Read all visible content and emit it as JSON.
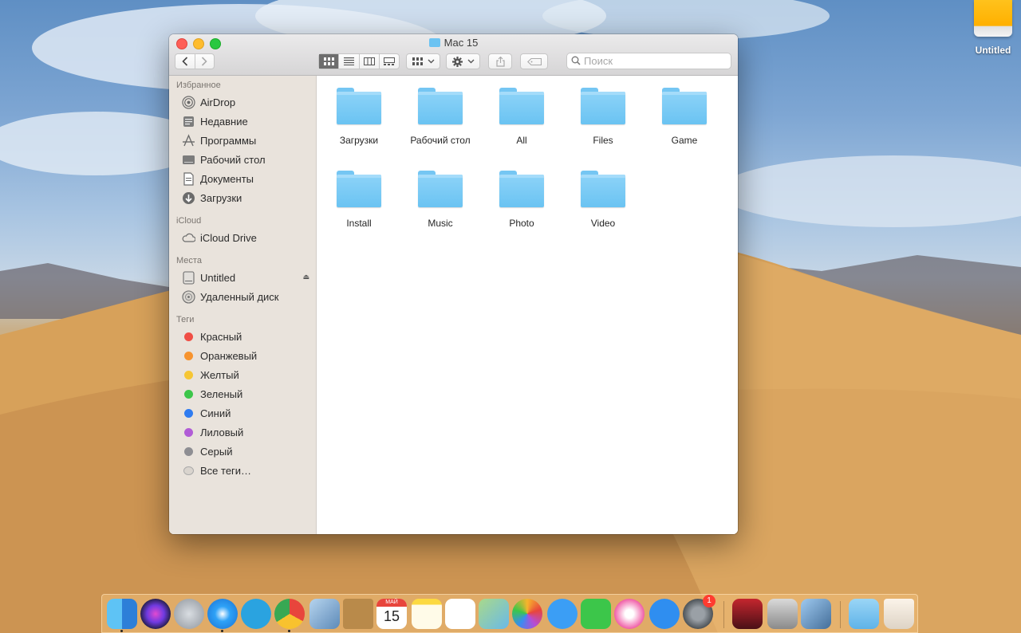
{
  "window": {
    "title": "Mac 15"
  },
  "search": {
    "placeholder": "Поиск"
  },
  "sidebar": {
    "favorites_label": "Избранное",
    "favorites": [
      {
        "label": "AirDrop",
        "icon": "airdrop-icon"
      },
      {
        "label": "Недавние",
        "icon": "recents-icon"
      },
      {
        "label": "Программы",
        "icon": "applications-icon"
      },
      {
        "label": "Рабочий стол",
        "icon": "desktop-icon"
      },
      {
        "label": "Документы",
        "icon": "documents-icon"
      },
      {
        "label": "Загрузки",
        "icon": "downloads-icon"
      }
    ],
    "icloud_label": "iCloud",
    "icloud": [
      {
        "label": "iCloud Drive",
        "icon": "cloud-icon"
      }
    ],
    "locations_label": "Места",
    "locations": [
      {
        "label": "Untitled",
        "icon": "drive-icon"
      },
      {
        "label": "Удаленный диск",
        "icon": "remote-disc-icon"
      }
    ],
    "tags_label": "Теги",
    "tags": [
      {
        "label": "Красный",
        "color": "#f04e45"
      },
      {
        "label": "Оранжевый",
        "color": "#f7932e"
      },
      {
        "label": "Желтый",
        "color": "#f6c634"
      },
      {
        "label": "Зеленый",
        "color": "#3cc64a"
      },
      {
        "label": "Синий",
        "color": "#2f7cf0"
      },
      {
        "label": "Лиловый",
        "color": "#b15cd6"
      },
      {
        "label": "Серый",
        "color": "#8e8e93"
      },
      {
        "label": "Все теги…",
        "color": "#d9d4ce"
      }
    ]
  },
  "folders": [
    "Загрузки",
    "Рабочий стол",
    "All",
    "Files",
    "Game",
    "Install",
    "Music",
    "Photo",
    "Video"
  ],
  "desktop": {
    "drive_label": "Untitled"
  },
  "dock": {
    "calendar_month": "МАЙ",
    "calendar_day": "15",
    "system_prefs_badge": "1"
  }
}
